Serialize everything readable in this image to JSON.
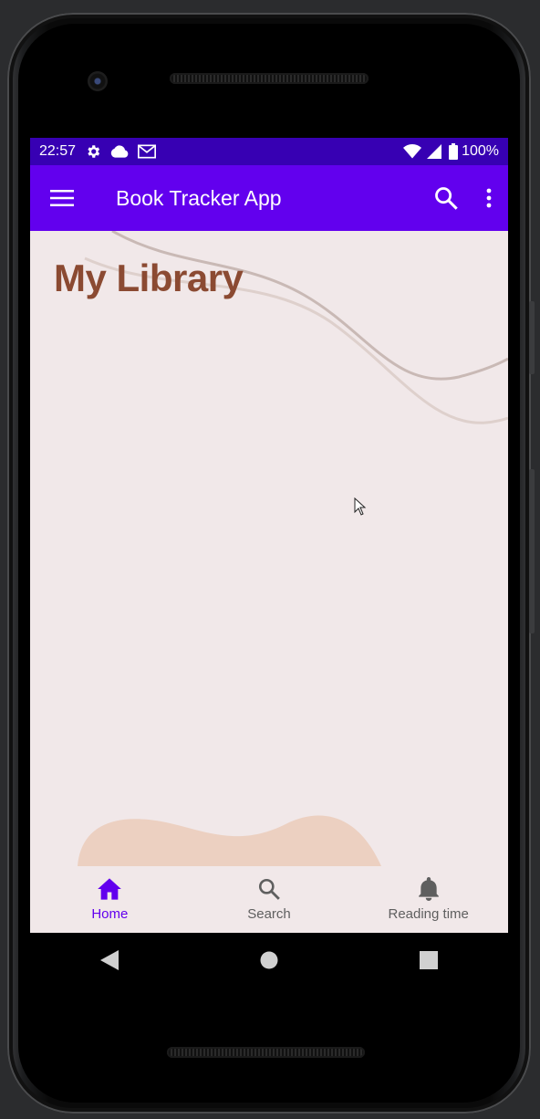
{
  "status_bar": {
    "time": "22:57",
    "left_icons": [
      "gear-icon",
      "cloud-icon",
      "gmail-icon"
    ],
    "right_icons": [
      "wifi-icon",
      "signal-icon",
      "battery-icon"
    ],
    "battery_text": "100%"
  },
  "app_bar": {
    "title": "Book Tracker App",
    "icons": [
      "hamburger-menu-icon",
      "search-icon",
      "more-vert-icon"
    ]
  },
  "main": {
    "page_title": "My Library"
  },
  "bottom_nav": {
    "items": [
      {
        "label": "Home",
        "icon": "home-icon",
        "active": true
      },
      {
        "label": "Search",
        "icon": "search-icon",
        "active": false
      },
      {
        "label": "Reading time",
        "icon": "bell-icon",
        "active": false
      }
    ]
  },
  "system_nav": {
    "icons": [
      "back-icon",
      "home-circle-icon",
      "recents-icon"
    ]
  },
  "colors": {
    "app_bar": "#6200ee",
    "status_bar": "#3700b3",
    "background": "#f1e8e9",
    "title_text": "#8b4a32",
    "active_nav": "#6200ee",
    "blob": "#ecd0c1"
  }
}
